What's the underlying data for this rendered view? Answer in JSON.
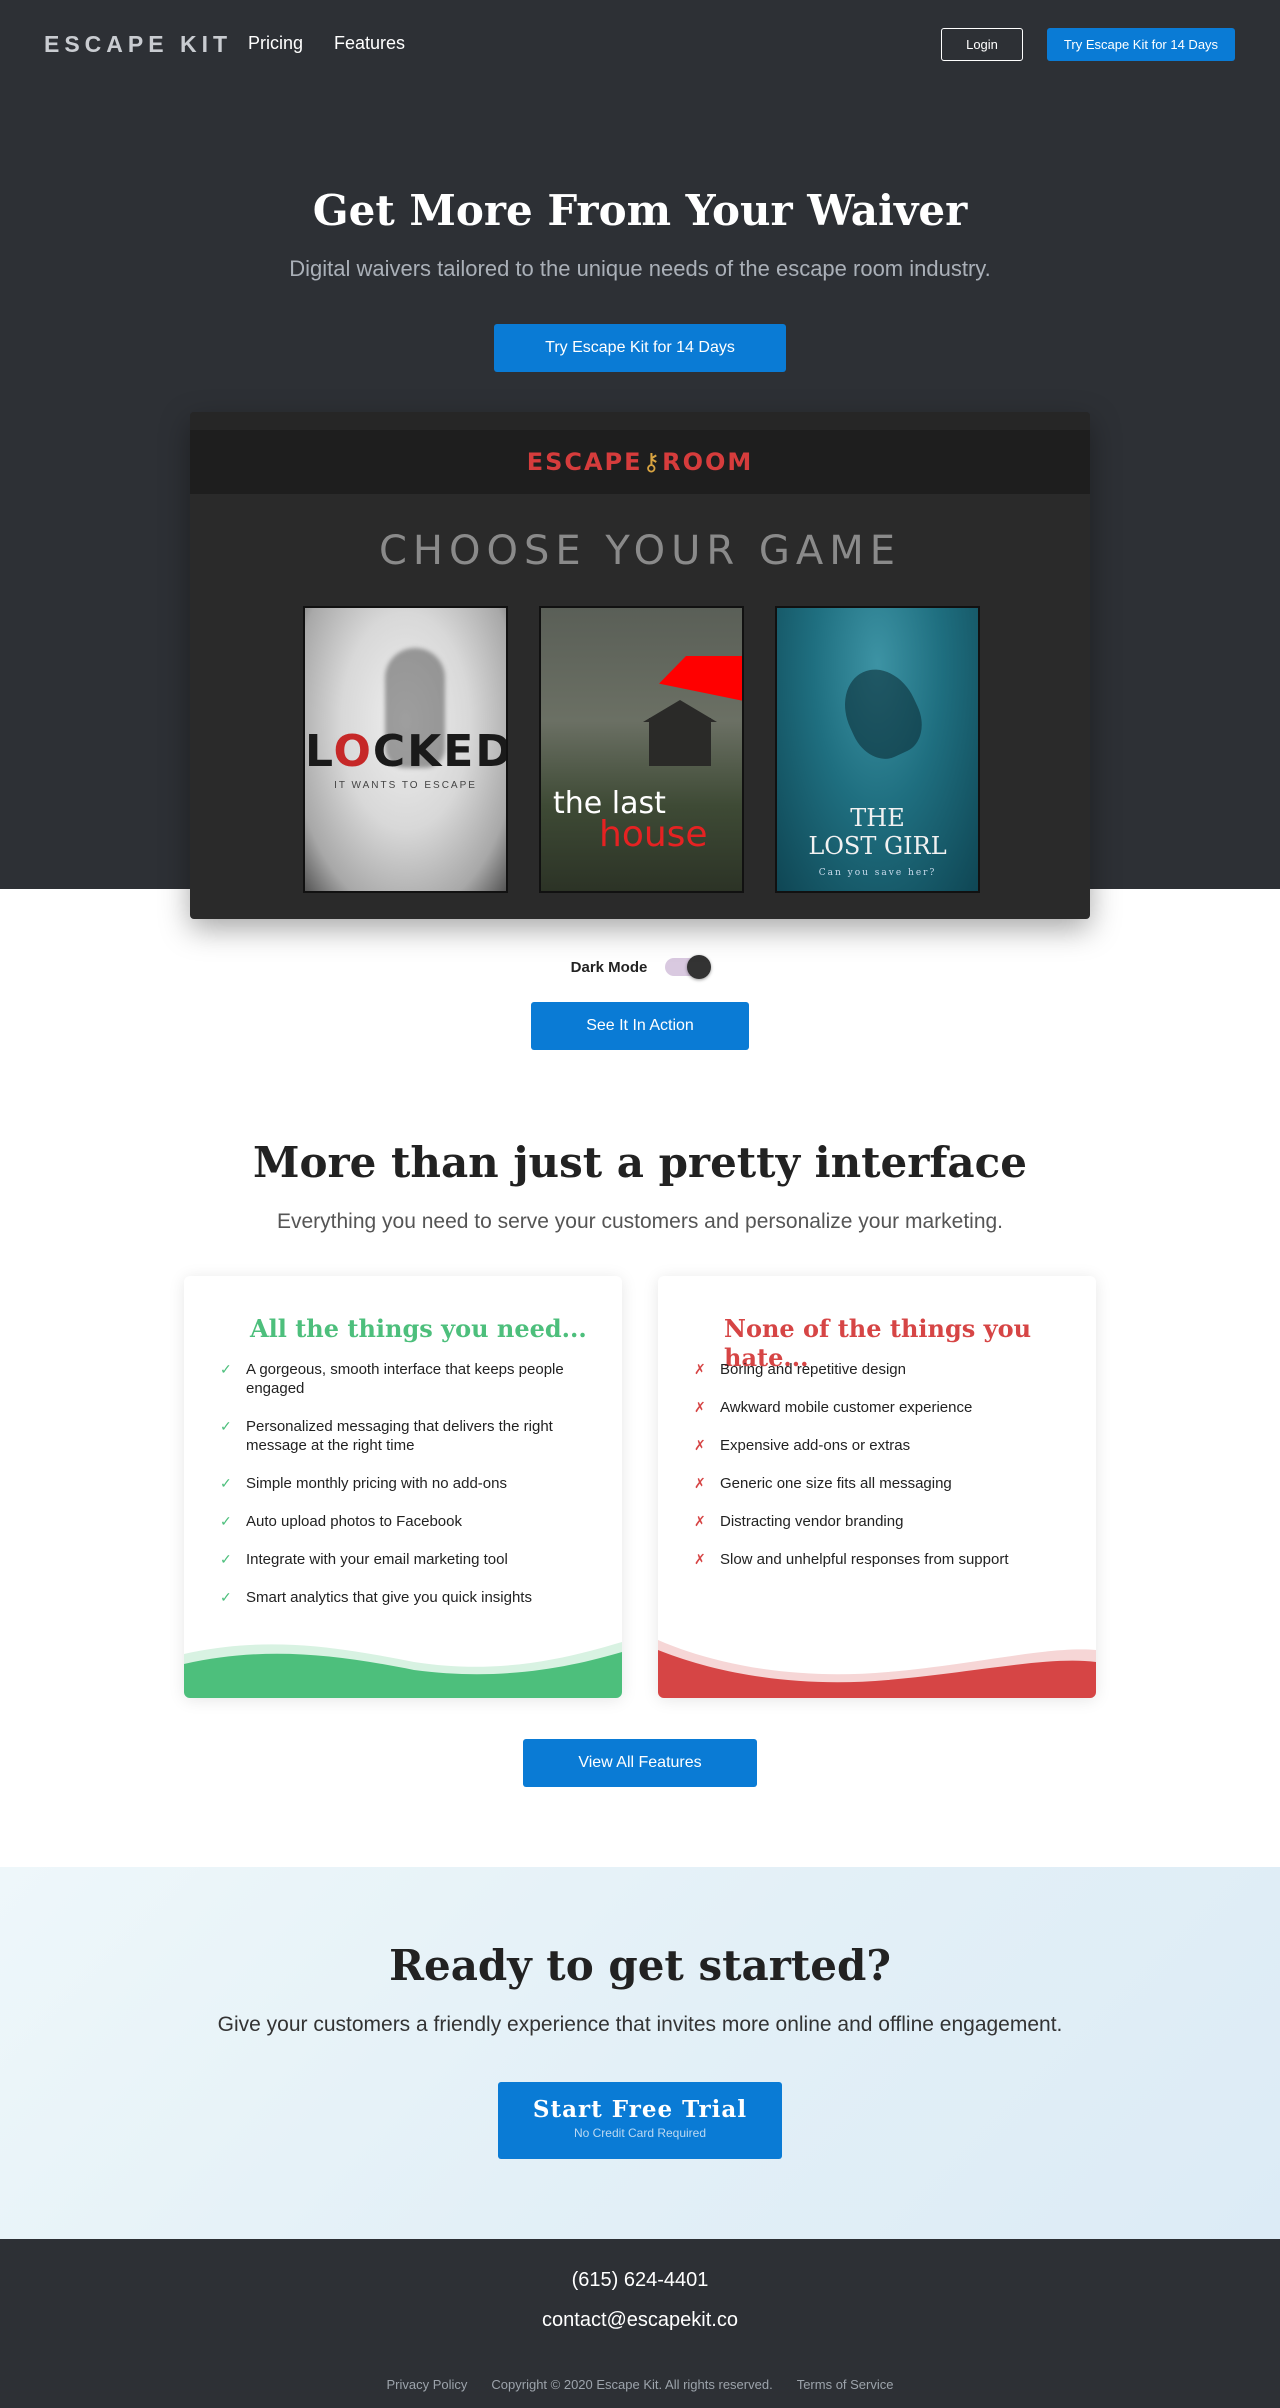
{
  "nav": {
    "logo": "ESCAPE KIT",
    "links": [
      "Pricing",
      "Features"
    ],
    "login": "Login",
    "trial": "Try Escape Kit for 14 Days"
  },
  "hero": {
    "title": "Get More From Your Waiver",
    "subtitle": "Digital waivers tailored to the unique needs of the escape room industry.",
    "cta": "Try Escape Kit for 14 Days"
  },
  "preview": {
    "brand_left": "ESCAPE",
    "brand_right": "ROOM",
    "heading": "CHOOSE YOUR GAME",
    "posters": [
      {
        "title_pre": "L",
        "title_red": "O",
        "title_post": "CKED",
        "tagline": "IT WANTS TO ESCAPE"
      },
      {
        "title_line1": "the last",
        "title_line2": "house"
      },
      {
        "title_line1": "THE",
        "title_line2": "LOST GIRL",
        "tagline": "Can you save her?"
      }
    ]
  },
  "toggle": {
    "label": "Dark Mode",
    "enabled": true
  },
  "action_button": "See It In Action",
  "features": {
    "title": "More than just a pretty interface",
    "subtitle": "Everything you need to serve your customers and personalize your marketing.",
    "need": {
      "title": "All the things you need...",
      "mark": "✓",
      "items": [
        "A gorgeous, smooth interface that keeps people engaged",
        "Personalized messaging that delivers the right message at the right time",
        "Simple monthly pricing with no add-ons",
        "Auto upload photos to Facebook",
        "Integrate with your email marketing tool",
        "Smart analytics that give you quick insights"
      ],
      "color": "#4dbf7c"
    },
    "hate": {
      "title": "None of the things you hate...",
      "mark": "✗",
      "items": [
        "Boring and repetitive design",
        "Awkward mobile customer experience",
        "Expensive add-ons or extras",
        "Generic one size fits all messaging",
        "Distracting vendor branding",
        "Slow and unhelpful responses from support"
      ],
      "color": "#d64545"
    },
    "view_all": "View All Features"
  },
  "cta": {
    "title": "Ready to get started?",
    "subtitle": "Give your customers a friendly experience that invites more online and offline engagement.",
    "button": "Start Free Trial",
    "button_sub": "No Credit Card Required"
  },
  "footer": {
    "phone": "(615) 624-4401",
    "email": "contact@escapekit.co",
    "privacy": "Privacy Policy",
    "copyright": "Copyright © 2020 Escape Kit. All rights reserved.",
    "terms": "Terms of Service"
  },
  "colors": {
    "primary": "#0a7bd5",
    "dark": "#2d3035",
    "success": "#4dbf7c",
    "danger": "#d64545"
  }
}
